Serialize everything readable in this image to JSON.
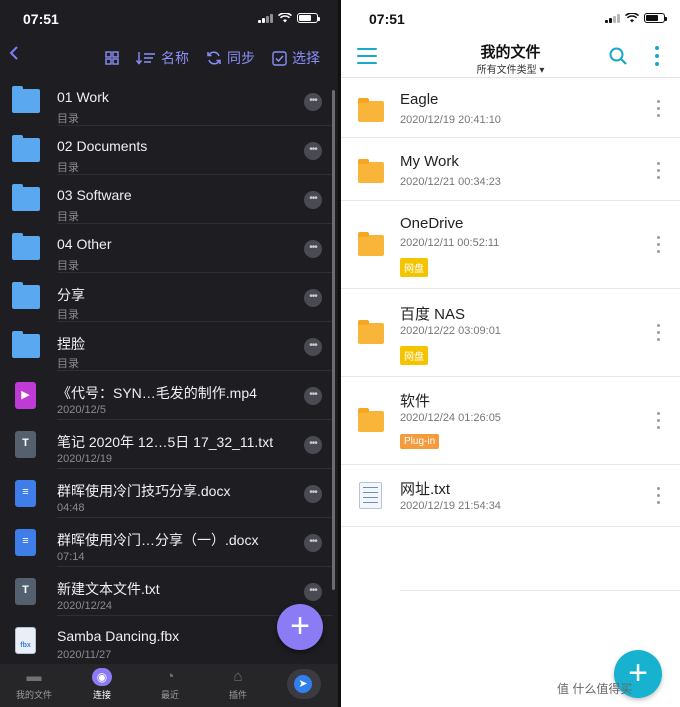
{
  "left": {
    "status": {
      "time": "07:51"
    },
    "toolbar": {
      "back_icon": "chevron-left-icon",
      "grid_icon": "grid-icon",
      "sort_label": "名称",
      "sync_label": "同步",
      "select_label": "选择"
    },
    "items": [
      {
        "name": "01 Work",
        "sub": "目录",
        "type": "folder"
      },
      {
        "name": "02 Documents",
        "sub": "目录",
        "type": "folder"
      },
      {
        "name": "03 Software",
        "sub": "目录",
        "type": "folder"
      },
      {
        "name": "04 Other",
        "sub": "目录",
        "type": "folder"
      },
      {
        "name": "分享",
        "sub": "目录",
        "type": "folder"
      },
      {
        "name": "捏脸",
        "sub": "目录",
        "type": "folder"
      },
      {
        "name": "《代号：SYN…毛发的制作.mp4",
        "sub": "2020/12/5",
        "type": "video"
      },
      {
        "name": "笔记 2020年 12…5日 17_32_11.txt",
        "sub": "2020/12/19",
        "type": "text"
      },
      {
        "name": "群晖使用冷门技巧分享.docx",
        "sub": "04:48",
        "type": "doc"
      },
      {
        "name": "群晖使用冷门…分享（一）.docx",
        "sub": "07:14",
        "type": "doc"
      },
      {
        "name": "新建文本文件.txt",
        "sub": "2020/12/24",
        "type": "text"
      },
      {
        "name": "Samba Dancing.fbx",
        "sub": "2020/11/27",
        "type": "fbx"
      }
    ],
    "tabbar": [
      {
        "label": "我的文件",
        "active": false
      },
      {
        "label": "连接",
        "active": true
      },
      {
        "label": "最近",
        "active": false
      },
      {
        "label": "插件",
        "active": false
      }
    ],
    "fab_label": "+",
    "colors": {
      "accent": "#8b7cf6",
      "folder": "#5aa8f0",
      "background": "#1e1e22"
    }
  },
  "right": {
    "status": {
      "time": "07:51"
    },
    "header": {
      "title": "我的文件",
      "subtitle": "所有文件类型 ▾"
    },
    "items": [
      {
        "name": "Eagle",
        "date": "2020/12/19 20:41:10",
        "type": "folder",
        "tag": null
      },
      {
        "name": "My Work",
        "date": "2020/12/21 00:34:23",
        "type": "folder",
        "tag": null
      },
      {
        "name": "OneDrive",
        "date": "2020/12/11 00:52:11",
        "type": "folder",
        "tag": "网盘"
      },
      {
        "name": "百度 NAS",
        "date": "2020/12/22 03:09:01",
        "type": "folder",
        "tag": "网盘"
      },
      {
        "name": "软件",
        "date": "2020/12/24 01:26:05",
        "type": "folder",
        "tag": "Plug-in"
      },
      {
        "name": "网址.txt",
        "date": "2020/12/19 21:54:34",
        "type": "file",
        "tag": null
      }
    ],
    "fab_label": "+",
    "watermark": "值 什么值得买",
    "colors": {
      "accent": "#1aa8c8",
      "folder": "#f9b43a",
      "tag_netdisk": "#f5c400",
      "tag_plugin": "#f59a3d"
    }
  }
}
